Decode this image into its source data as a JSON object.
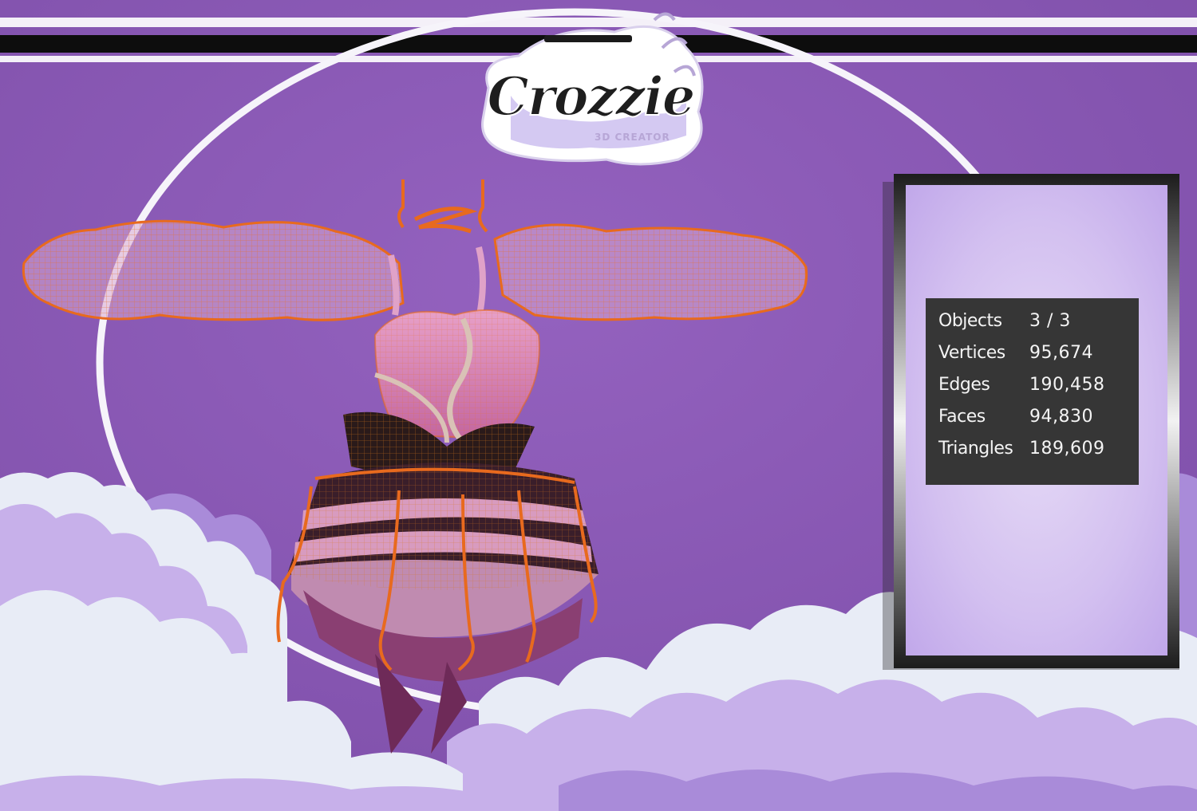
{
  "branding": {
    "logo_title": "Crozzie",
    "logo_subtitle": "3D CREATOR"
  },
  "colors": {
    "background": "#8a58b4",
    "background_dark": "#7d4ea8",
    "cloud_light": "#e8ecf6",
    "cloud_lavender": "#c7b0ea",
    "cloud_violet": "#a98bd9",
    "wireframe": "#e86a1e",
    "garment_pink": "#d887b6",
    "panel_bg": "#363636",
    "panel_text": "#f4f4f4"
  },
  "stats": [
    {
      "label": "Objects",
      "value": "3 / 3"
    },
    {
      "label": "Vertices",
      "value": "95,674"
    },
    {
      "label": "Edges",
      "value": "190,458"
    },
    {
      "label": "Faces",
      "value": "94,830"
    },
    {
      "label": "Triangles",
      "value": "189,609"
    }
  ]
}
